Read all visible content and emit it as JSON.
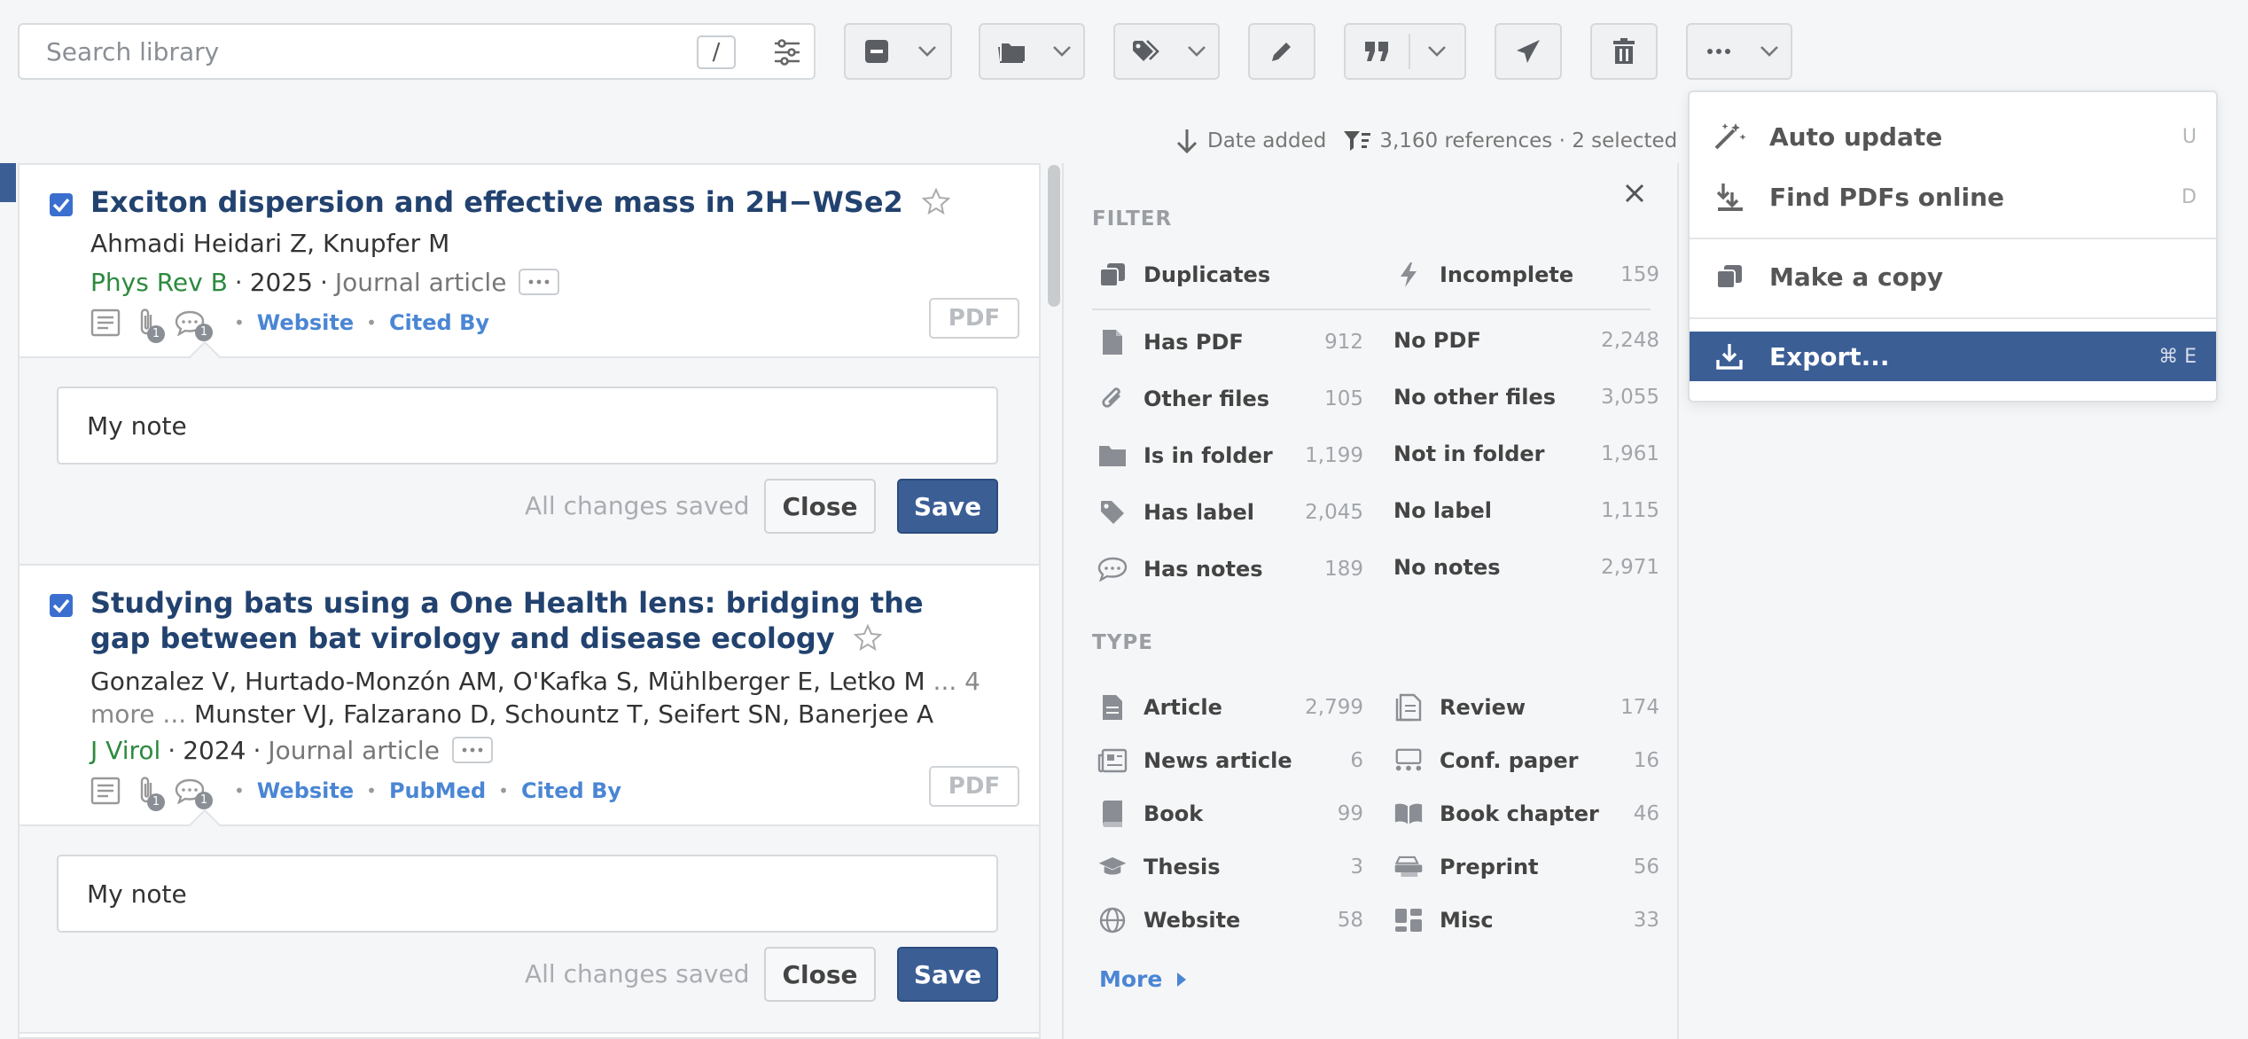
{
  "search": {
    "placeholder": "Search library",
    "shortcut": "/"
  },
  "status": {
    "sort_label": "Date added",
    "counts": "3,160 references · 2 selected"
  },
  "references": [
    {
      "title": "Exciton dispersion and effective mass in 2H−WSe2",
      "authors": "Ahmadi Heidari Z, Knupfer M",
      "journal": "Phys Rev B",
      "year": "2025",
      "type": "Journal article",
      "links": [
        "Website",
        "Cited By"
      ],
      "attachments_count": "1",
      "comments_count": "1",
      "pdf_label": "PDF",
      "note": {
        "value": "My note",
        "saved": "All changes saved",
        "close": "Close",
        "save": "Save"
      }
    },
    {
      "title": "Studying bats using a One Health lens: bridging the gap between bat virology and disease ecology",
      "authors_before": "Gonzalez V, Hurtado-Monzón AM, O'Kafka S, Mühlberger E, Letko M",
      "authors_more": " ... 4 more ... ",
      "authors_after": "Munster VJ, Falzarano D, Schountz T, Seifert SN, Banerjee A",
      "journal": "J Virol",
      "year": "2024",
      "type": "Journal article",
      "links": [
        "Website",
        "PubMed",
        "Cited By"
      ],
      "attachments_count": "1",
      "comments_count": "1",
      "pdf_label": "PDF",
      "note": {
        "value": "My note",
        "saved": "All changes saved",
        "close": "Close",
        "save": "Save"
      }
    }
  ],
  "filter": {
    "title": "FILTER",
    "top": [
      {
        "label": "Duplicates",
        "count": "",
        "icon": "duplicates-icon"
      },
      {
        "label": "Incomplete",
        "count": "159",
        "icon": "lightning-icon"
      }
    ],
    "pairs": [
      {
        "label": "Has PDF",
        "count": "912",
        "neg_label": "No PDF",
        "neg_count": "2,248",
        "icon": "document-icon"
      },
      {
        "label": "Other files",
        "count": "105",
        "neg_label": "No other files",
        "neg_count": "3,055",
        "icon": "paperclip-icon"
      },
      {
        "label": "Is in folder",
        "count": "1,199",
        "neg_label": "Not in folder",
        "neg_count": "1,961",
        "icon": "folder-icon"
      },
      {
        "label": "Has label",
        "count": "2,045",
        "neg_label": "No label",
        "neg_count": "1,115",
        "icon": "tag-icon"
      },
      {
        "label": "Has notes",
        "count": "189",
        "neg_label": "No notes",
        "neg_count": "2,971",
        "icon": "comment-icon"
      }
    ],
    "type_title": "TYPE",
    "types": [
      {
        "label": "Article",
        "count": "2,799",
        "icon": "article-icon"
      },
      {
        "label": "Review",
        "count": "174",
        "icon": "review-icon"
      },
      {
        "label": "News article",
        "count": "6",
        "icon": "newspaper-icon"
      },
      {
        "label": "Conf. paper",
        "count": "16",
        "icon": "conference-icon"
      },
      {
        "label": "Book",
        "count": "99",
        "icon": "book-icon"
      },
      {
        "label": "Book chapter",
        "count": "46",
        "icon": "open-book-icon"
      },
      {
        "label": "Thesis",
        "count": "3",
        "icon": "graduation-cap-icon"
      },
      {
        "label": "Preprint",
        "count": "56",
        "icon": "preprint-icon"
      },
      {
        "label": "Website",
        "count": "58",
        "icon": "globe-icon"
      },
      {
        "label": "Misc",
        "count": "33",
        "icon": "misc-icon"
      }
    ],
    "more_label": "More"
  },
  "menu": {
    "items": [
      {
        "label": "Auto update",
        "shortcut": "U",
        "icon": "magic-wand-icon"
      },
      {
        "label": "Find PDFs online",
        "shortcut": "D",
        "icon": "download-arrows-icon"
      },
      {
        "label": "Make a copy",
        "shortcut": "",
        "icon": "copy-icon"
      },
      {
        "label": "Export...",
        "shortcut": "⌘ E",
        "icon": "export-download-icon",
        "active": true
      }
    ]
  },
  "colors": {
    "accent": "#3b5e95",
    "link": "#4a86d4",
    "journal": "#2c8a3e",
    "title": "#22426f"
  }
}
